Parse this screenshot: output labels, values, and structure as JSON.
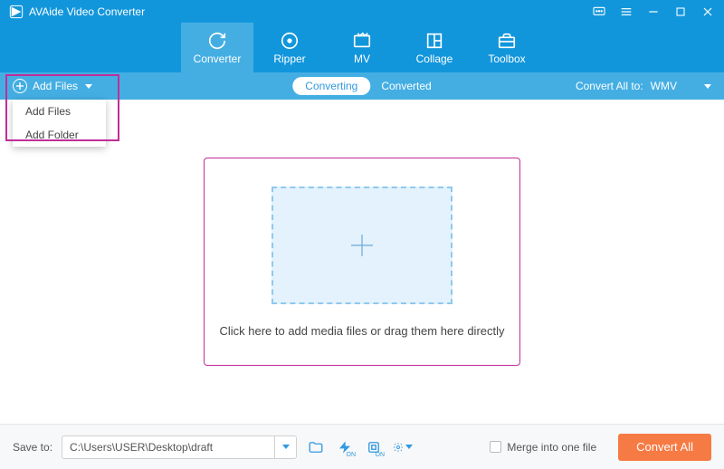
{
  "titlebar": {
    "app_name": "AVAide Video Converter"
  },
  "nav": {
    "tabs": [
      "Converter",
      "Ripper",
      "MV",
      "Collage",
      "Toolbox"
    ],
    "active": 0
  },
  "subheader": {
    "add_label": "Add Files",
    "status": {
      "converting": "Converting",
      "converted": "Converted"
    },
    "convert_all_label": "Convert All to:",
    "format": "WMV"
  },
  "dropdown": {
    "items": [
      "Add Files",
      "Add Folder"
    ]
  },
  "dropzone": {
    "text": "Click here to add media files or drag them here directly"
  },
  "footer": {
    "save_label": "Save to:",
    "path": "C:\\Users\\USER\\Desktop\\draft",
    "merge_label": "Merge into one file",
    "convert_label": "Convert All"
  }
}
